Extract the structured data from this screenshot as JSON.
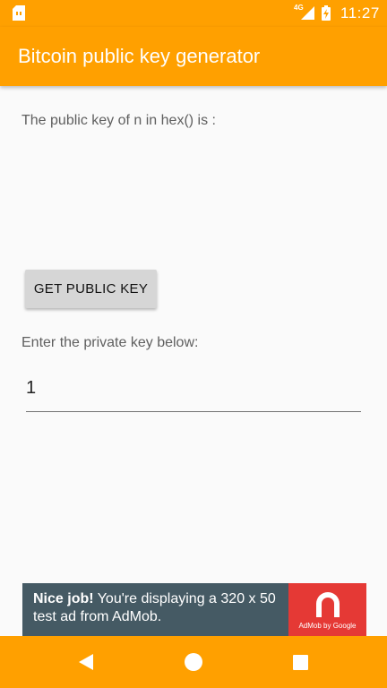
{
  "status_bar": {
    "network": "4G",
    "time": "11:27",
    "icons": [
      "sim-card-icon",
      "signal-icon",
      "battery-charging-icon"
    ]
  },
  "app_bar": {
    "title": "Bitcoin public key generator"
  },
  "main": {
    "result_label": "The public key of n in hex() is :",
    "button_label": "GET PUBLIC KEY",
    "prompt_label": "Enter the private key below:",
    "input_value": "1"
  },
  "ad": {
    "headline": "Nice job!",
    "body": " You're displaying a 320 x 50 test ad from AdMob.",
    "brand_caption": "AdMob by Google"
  },
  "nav_bar": {
    "icons": [
      "back-icon",
      "home-icon",
      "recents-icon"
    ]
  },
  "colors": {
    "primary": "#ffa000",
    "ad_background": "#455a64",
    "ad_logo_background": "#e53935",
    "button_background": "#d6d6d6"
  }
}
